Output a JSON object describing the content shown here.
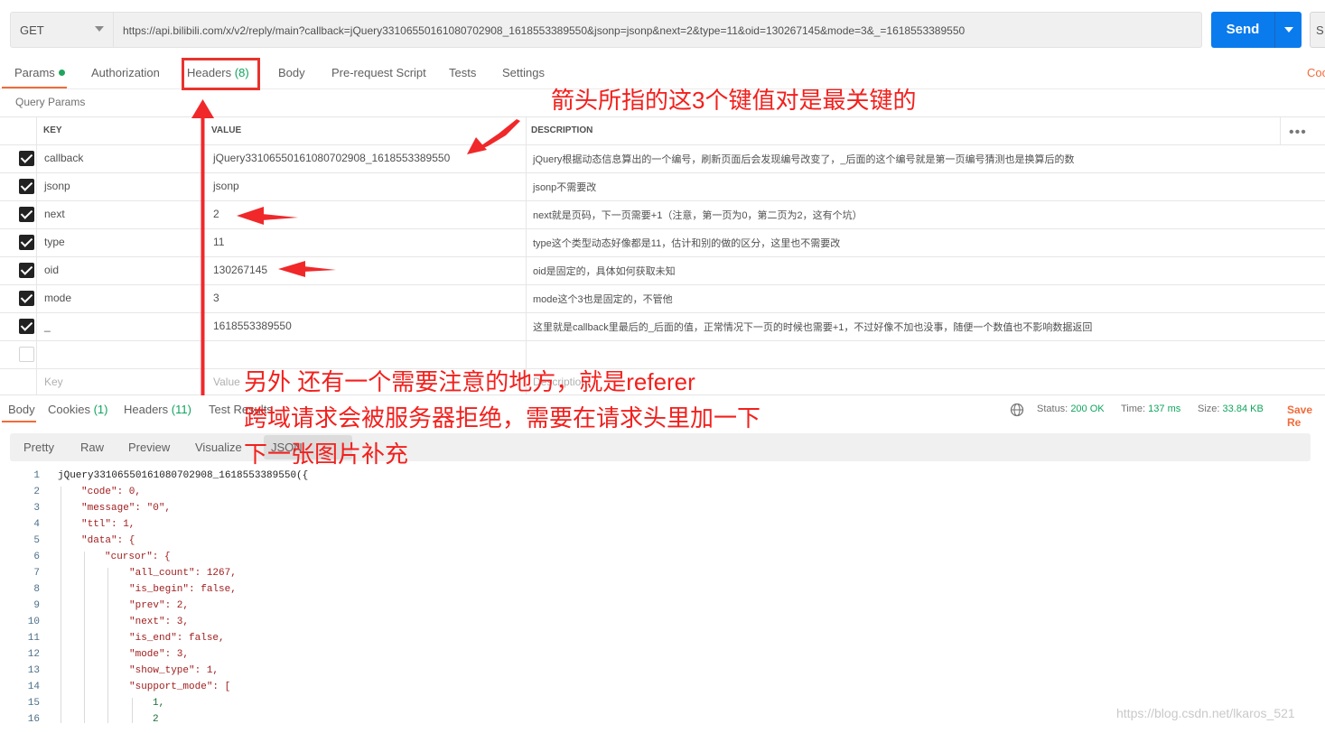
{
  "request": {
    "method": "GET",
    "url": "https://api.bilibili.com/x/v2/reply/main?callback=jQuery33106550161080702908_1618553389550&jsonp=jsonp&next=2&type=11&oid=130267145&mode=3&_=1618553389550",
    "send_label": "Send",
    "save_stub": "S"
  },
  "request_tabs": [
    {
      "label": "Params",
      "count": ""
    },
    {
      "label": "Authorization",
      "count": ""
    },
    {
      "label": "Headers",
      "count": "(8)"
    },
    {
      "label": "Body",
      "count": ""
    },
    {
      "label": "Pre-request Script",
      "count": ""
    },
    {
      "label": "Tests",
      "count": ""
    },
    {
      "label": "Settings",
      "count": ""
    }
  ],
  "cookies_link": "Coo",
  "query_params_title": "Query Params",
  "table": {
    "headers": {
      "key": "KEY",
      "value": "VALUE",
      "description": "DESCRIPTION"
    },
    "rows": [
      {
        "key": "callback",
        "value": "jQuery33106550161080702908_1618553389550",
        "description": "jQuery根据动态信息算出的一个编号，刷新页面后会发现编号改变了，_后面的这个编号就是第一页编号猜测也是换算后的数"
      },
      {
        "key": "jsonp",
        "value": "jsonp",
        "description": "jsonp不需要改"
      },
      {
        "key": "next",
        "value": "2",
        "description": "next就是页码，下一页需要+1（注意，第一页为0，第二页为2，这有个坑）"
      },
      {
        "key": "type",
        "value": "11",
        "description": "type这个类型动态好像都是11，估计和别的做的区分，这里也不需要改"
      },
      {
        "key": "oid",
        "value": "130267145",
        "description": "oid是固定的，具体如何获取未知"
      },
      {
        "key": "mode",
        "value": "3",
        "description": "mode这个3也是固定的，不管他"
      },
      {
        "key": "_",
        "value": "1618553389550",
        "description": "这里就是callback里最后的_后面的值，正常情况下一页的时候也需要+1，不过好像不加也没事，随便一个数值也不影响数据返回"
      }
    ],
    "new_key_placeholder": "Key",
    "new_value_placeholder": "Value",
    "new_desc_placeholder": "Description"
  },
  "response_tabs": [
    {
      "label": "Body",
      "count": ""
    },
    {
      "label": "Cookies",
      "count": "(1)"
    },
    {
      "label": "Headers",
      "count": "(11)"
    },
    {
      "label": "Test Results",
      "count": ""
    }
  ],
  "status": {
    "status_label": "Status:",
    "status_value": "200 OK",
    "time_label": "Time:",
    "time_value": "137 ms",
    "size_label": "Size:",
    "size_value": "33.84 KB",
    "save_label": "Save Re"
  },
  "view_buttons": [
    "Pretty",
    "Raw",
    "Preview",
    "Visualize",
    "JSON"
  ],
  "code_lines": [
    {
      "n": "1",
      "text": "jQuery33106550161080702908_1618553389550({"
    },
    {
      "n": "2",
      "text": "\"code\": 0,"
    },
    {
      "n": "3",
      "text": "\"message\": \"0\","
    },
    {
      "n": "4",
      "text": "\"ttl\": 1,"
    },
    {
      "n": "5",
      "text": "\"data\": {"
    },
    {
      "n": "6",
      "text": "\"cursor\": {"
    },
    {
      "n": "7",
      "text": "\"all_count\": 1267,"
    },
    {
      "n": "8",
      "text": "\"is_begin\": false,"
    },
    {
      "n": "9",
      "text": "\"prev\": 2,"
    },
    {
      "n": "10",
      "text": "\"next\": 3,"
    },
    {
      "n": "11",
      "text": "\"is_end\": false,"
    },
    {
      "n": "12",
      "text": "\"mode\": 3,"
    },
    {
      "n": "13",
      "text": "\"show_type\": 1,"
    },
    {
      "n": "14",
      "text": "\"support_mode\": ["
    },
    {
      "n": "15",
      "text": "1,"
    },
    {
      "n": "16",
      "text": "2"
    }
  ],
  "annotations": {
    "top": "箭头所指的这3个键值对是最关键的",
    "middle_line1": "另外 还有一个需要注意的地方，就是referer",
    "middle_line2": "跨域请求会被服务器拒绝，需要在请求头里加一下",
    "middle_line3": "下一张图片补充"
  },
  "watermark": "https://blog.csdn.net/lkaros_521",
  "colors": {
    "accent": "#f26b3a",
    "send": "#097bed",
    "annotation": "#f2201d",
    "ok": "#10a45d"
  }
}
